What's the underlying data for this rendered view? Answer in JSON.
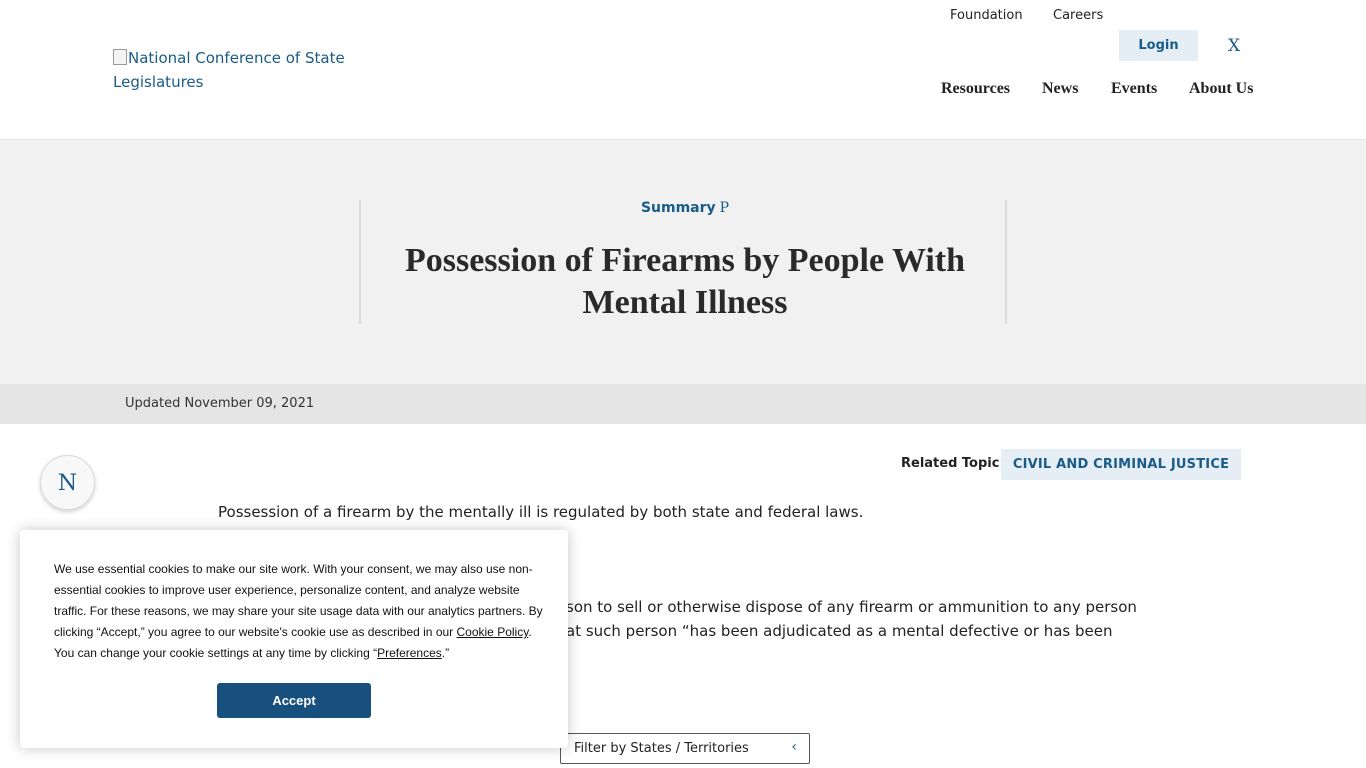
{
  "header": {
    "logo_alt": "National Conference of State Legislatures",
    "util_nav": {
      "foundation": "Foundation",
      "careers": "Careers",
      "login": "Login",
      "x_icon_glyph": "X"
    },
    "main_nav": [
      "Resources",
      "News",
      "Events",
      "About Us"
    ]
  },
  "hero": {
    "kicker": "Summary",
    "kicker_icon": "P",
    "title_line1": "Possession of Firearms by People With",
    "title_line2": "Mental Illness"
  },
  "updated": "Updated November 09, 2021",
  "side_badge": "N",
  "related": {
    "label": "Related Topic:",
    "tag": "CIVIL AND CRIMINAL JUSTICE"
  },
  "body": {
    "para1": "Possession of a firearm by the mentally ill is regulated by both state and federal laws.",
    "para2_line1": "son to sell or otherwise dispose of any firearm or ammunition to any person",
    "para2_line2": "at such person “has been adjudicated as a mental defective or has been"
  },
  "filter": {
    "label": "Filter by States / Territories",
    "caret": "‹"
  },
  "cookie": {
    "text_before": "We use essential cookies to make our site work. With your consent, we may also use non-essential cookies to improve user experience, personalize content, and analyze website traffic. For these reasons, we may share your site usage data with our analytics partners. By clicking “Accept,” you agree to our website's cookie use as described in our ",
    "cookie_policy_link": "Cookie Policy",
    "text_middle": ". You can change your cookie settings at any time by clicking “",
    "preferences_link": "Preferences",
    "text_after": ".”",
    "accept_label": "Accept"
  }
}
